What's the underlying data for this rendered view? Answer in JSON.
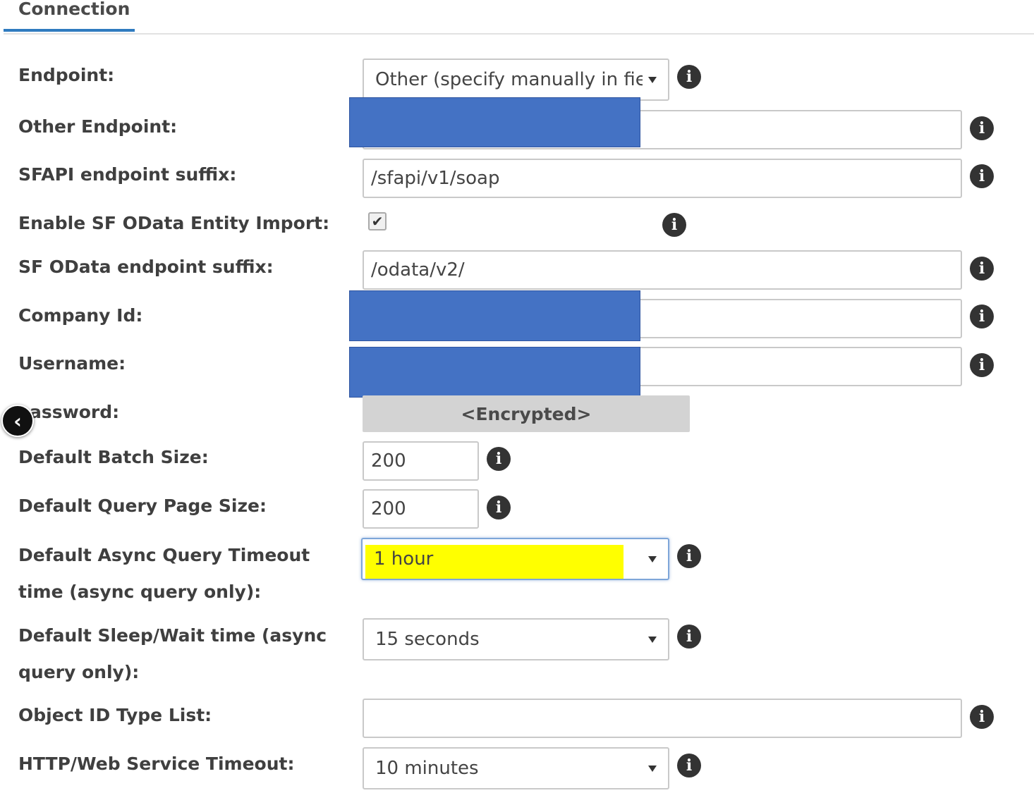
{
  "tab": {
    "label": "Connection"
  },
  "fields": {
    "endpoint": {
      "label": "Endpoint:",
      "value": "Other (specify manually in field"
    },
    "other_endpoint": {
      "label": "Other Endpoint:",
      "value": ""
    },
    "sfapi_suffix": {
      "label": "SFAPI endpoint suffix:",
      "value": "/sfapi/v1/soap"
    },
    "odata_import": {
      "label": "Enable SF OData Entity Import:",
      "checked": true,
      "check_glyph": "✔"
    },
    "odata_suffix": {
      "label": "SF OData endpoint suffix:",
      "value": "/odata/v2/"
    },
    "company_id": {
      "label": "Company Id:",
      "value": ""
    },
    "username": {
      "label": "Username:",
      "value": ""
    },
    "password": {
      "label": "assword:",
      "value": "<Encrypted>"
    },
    "batch_size": {
      "label": "Default Batch Size:",
      "value": "200"
    },
    "page_size": {
      "label": "Default Query Page Size:",
      "value": "200"
    },
    "async_timeout": {
      "label": "Default Async Query Timeout time (async query only):",
      "value": "1 hour"
    },
    "sleep_wait": {
      "label": "Default Sleep/Wait time (async query only):",
      "value": "15 seconds"
    },
    "object_id_type_list": {
      "label": "Object ID Type List:",
      "value": ""
    },
    "http_timeout": {
      "label": "HTTP/Web Service Timeout:",
      "value": "10 minutes"
    }
  },
  "icons": {
    "info": "i",
    "back": "‹"
  },
  "colors": {
    "accent": "#2f7bbf",
    "redaction": "#4472c4",
    "highlight": "#ffff00"
  }
}
